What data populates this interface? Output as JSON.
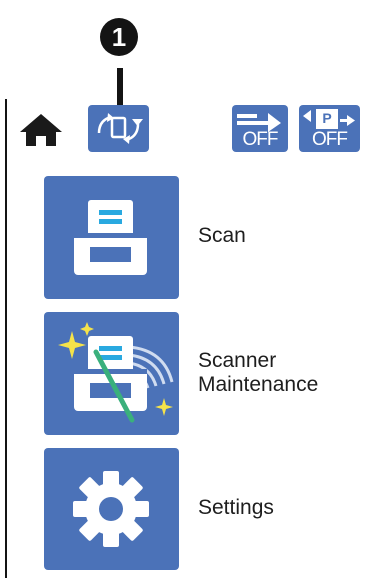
{
  "callout": {
    "number": "1"
  },
  "top_bar": {
    "home_icon": "home-icon",
    "rotate_icon": "screen-rotate-icon",
    "indicator_1": {
      "icon": "double-feed-arrow-icon",
      "status": "OFF"
    },
    "indicator_2": {
      "icon": "paper-protection-icon",
      "letter": "P",
      "status": "OFF"
    }
  },
  "menu": {
    "items": [
      {
        "label": "Scan",
        "icon": "scanner-icon"
      },
      {
        "label": "Scanner\nMaintenance",
        "icon": "scanner-cleaning-icon"
      },
      {
        "label": "Settings",
        "icon": "gear-icon"
      }
    ]
  },
  "colors": {
    "accent": "#4b72b8",
    "accent_light": "#29a9e0",
    "sparkle": "#f5e34a",
    "wand": "#3ab07c",
    "ink": "#141414"
  }
}
